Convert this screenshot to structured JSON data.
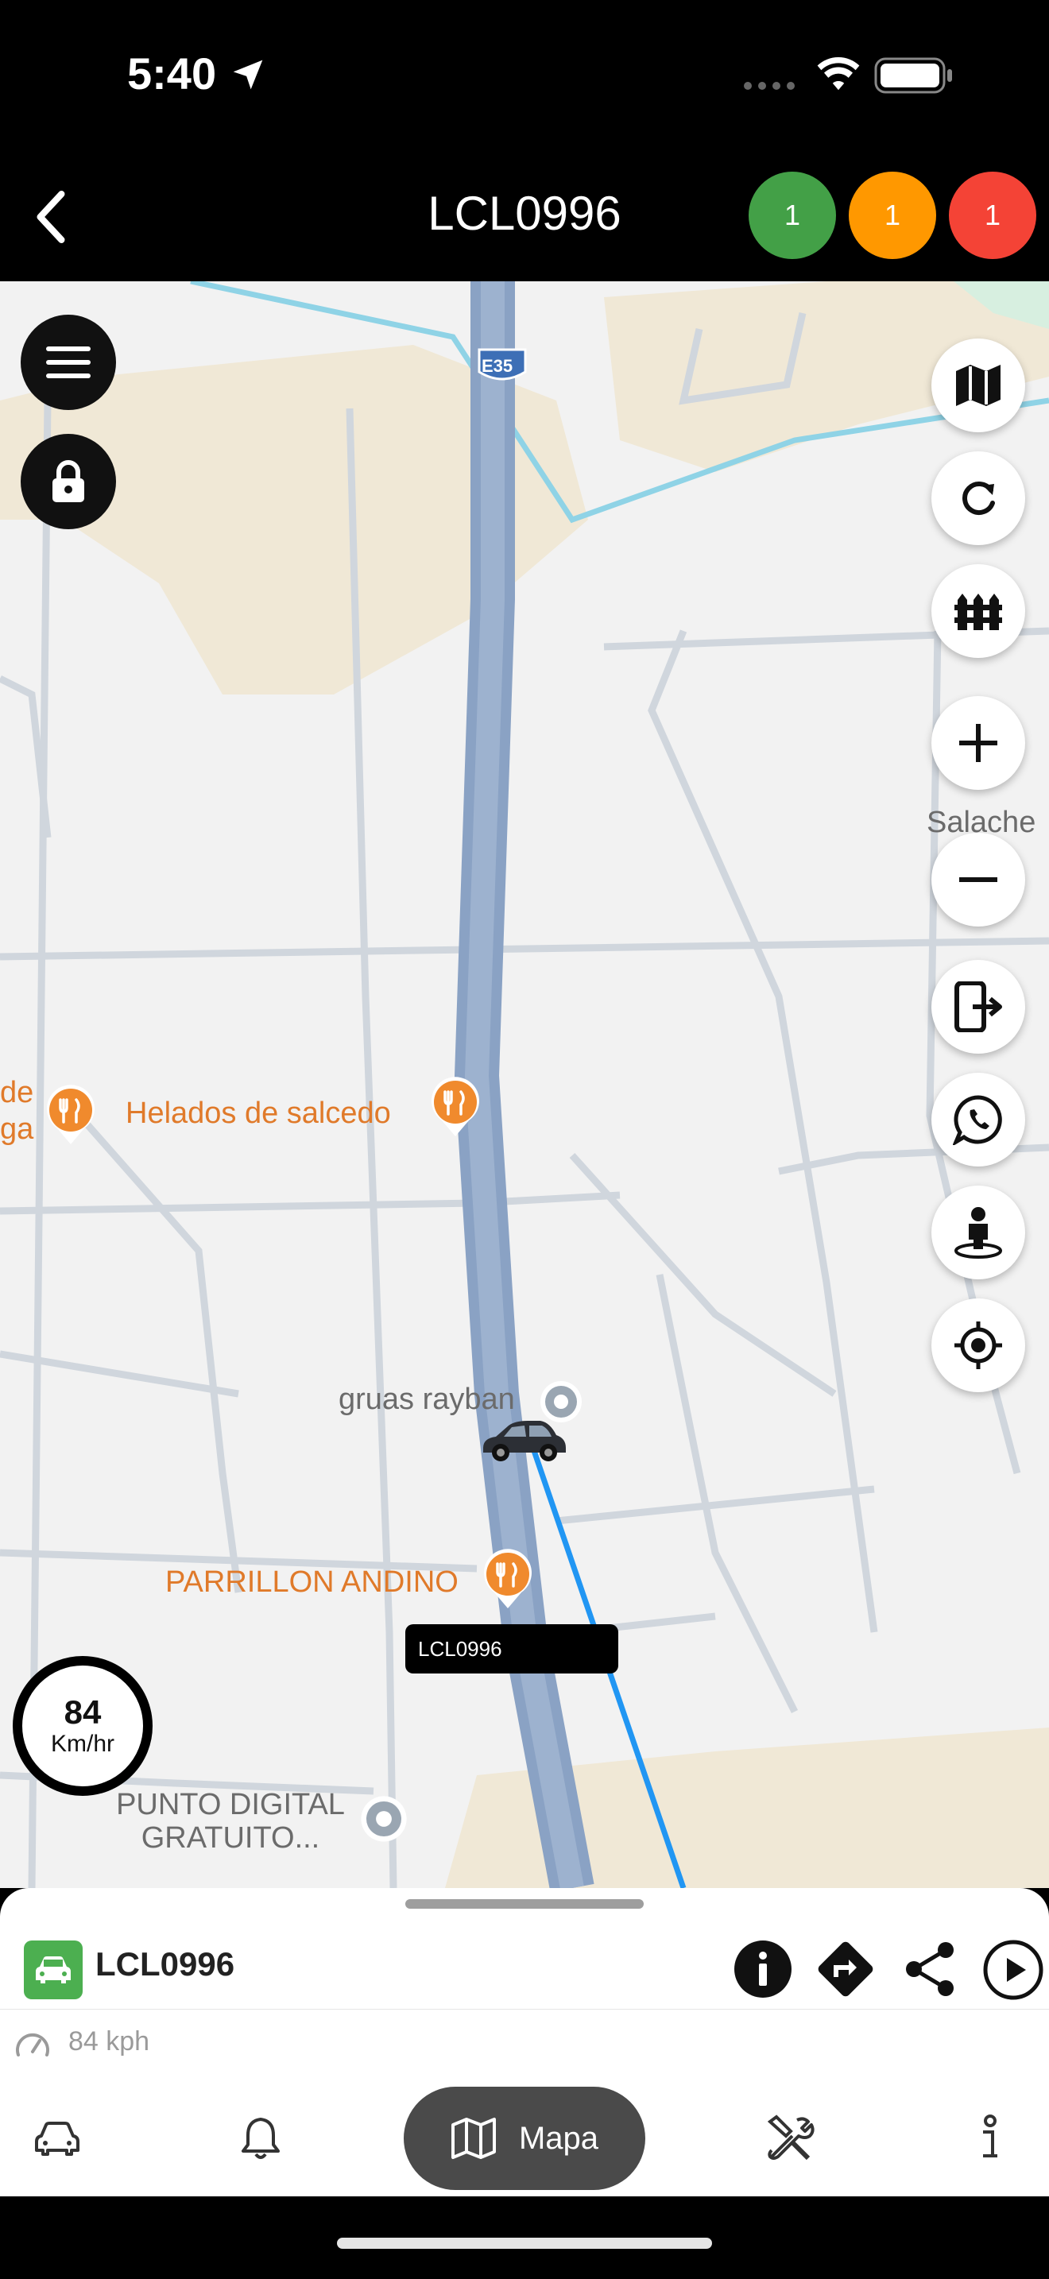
{
  "status_bar": {
    "time": "5:40"
  },
  "header": {
    "title": "LCL0996",
    "counters": [
      {
        "value": "1",
        "color": "#43a047"
      },
      {
        "value": "1",
        "color": "#ff9800"
      },
      {
        "value": "1",
        "color": "#f44336"
      }
    ]
  },
  "map": {
    "labels": {
      "highway": "E35",
      "salache": "Salache",
      "helados": "Helados de salcedo",
      "left_cut_1": "de",
      "left_cut_2": "ga",
      "gruas": "gruas rayban",
      "parrillon": "PARRILLON ANDINO",
      "punto_line1": "PUNTO DIGITAL",
      "punto_line2": "GRATUITO..."
    },
    "vehicle_tag": "LCL0996",
    "speed": {
      "value": "84",
      "unit": "Km/hr"
    },
    "accent_route_color": "#2196f3"
  },
  "sheet": {
    "plate": "LCL0996",
    "speed_text": "84 kph"
  },
  "nav": {
    "active_label": "Mapa"
  }
}
